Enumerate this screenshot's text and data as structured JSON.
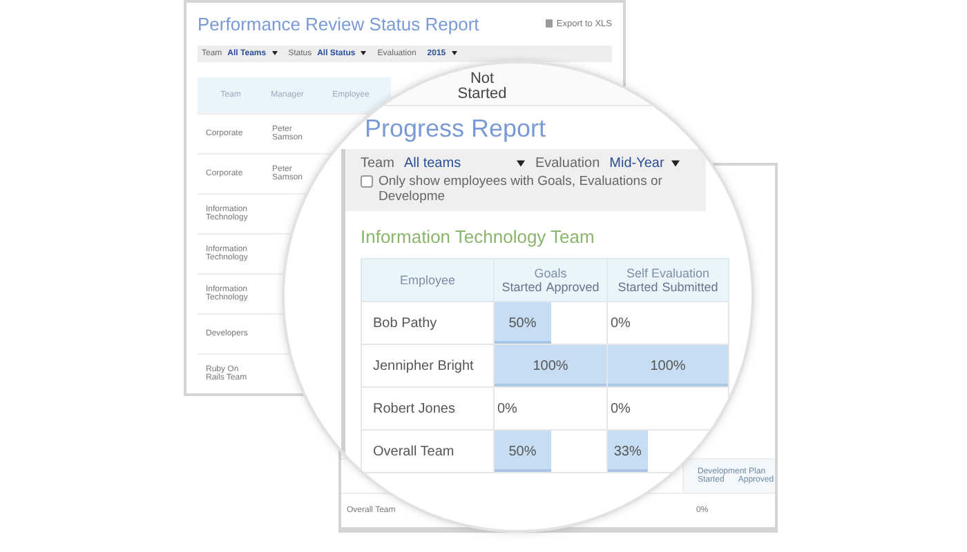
{
  "background_report": {
    "title": "Performance Review Status Report",
    "export_label": "Export to XLS",
    "filters": [
      {
        "label": "Team",
        "value": "All Teams"
      },
      {
        "label": "Status",
        "value": "All Status"
      },
      {
        "label": "Evaluation"
      },
      {
        "value": "2015"
      }
    ],
    "columns": [
      "Team",
      "Manager",
      "Employee"
    ],
    "rows": [
      {
        "team": "Corporate",
        "manager": "Peter Samson"
      },
      {
        "team": "Corporate",
        "manager": "Peter Samson"
      },
      {
        "team": "Information Technology"
      },
      {
        "team": "Information Technology"
      },
      {
        "team": "Information Technology"
      },
      {
        "team": "Developers"
      },
      {
        "team": "Ruby On Rails Team"
      }
    ]
  },
  "middle_report": {
    "development_plan": {
      "title": "Development Plan",
      "columns": [
        "Started",
        "Approved"
      ]
    },
    "footer": {
      "label": "Overall Team",
      "value": "0%"
    }
  },
  "progress_report": {
    "column_heading": "Not Started",
    "title": "Progress Report",
    "filters": [
      {
        "label": "Team",
        "value": "All teams"
      },
      {
        "label": "Evaluation",
        "value": "Mid-Year"
      }
    ],
    "checkbox": {
      "label": "Only show employees with Goals, Evaluations or Developme",
      "checked": false
    },
    "section_title": "Information Technology Team",
    "columns": [
      {
        "title": "Employee"
      },
      {
        "title": "Goals",
        "subcolumns": [
          "Started",
          "Approved"
        ]
      },
      {
        "title": "Self Evaluation",
        "subcolumns": [
          "Started",
          "Submitted"
        ]
      }
    ],
    "rows": [
      {
        "name": "Bob Pathy",
        "goals": {
          "value": "50%",
          "level": 0.5
        },
        "self_evaluation": {
          "value": "0%",
          "level": 0
        }
      },
      {
        "name": "Jennipher Bright",
        "goals": {
          "value": "100%",
          "level": 1
        },
        "self_evaluation": {
          "value": "100%",
          "level": 1
        }
      },
      {
        "name": "Robert Jones",
        "goals": {
          "value": "0%",
          "level": 0
        },
        "self_evaluation": {
          "value": "0%",
          "level": 0
        }
      },
      {
        "name": "Overall Team",
        "goals": {
          "value": "50%",
          "level": 0.5
        },
        "self_evaluation": {
          "value": "33%",
          "level": 0.33
        }
      }
    ]
  }
}
